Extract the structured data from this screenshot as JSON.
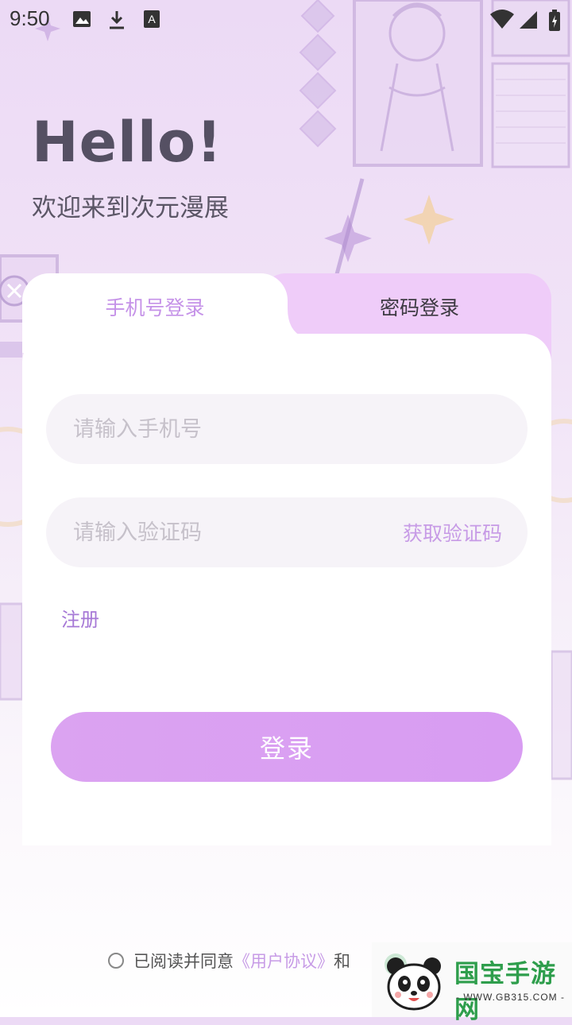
{
  "status_bar": {
    "time": "9:50",
    "icons": [
      "image-icon",
      "download-icon",
      "font-icon",
      "wifi-icon",
      "signal-icon",
      "battery-icon"
    ]
  },
  "greeting": {
    "title": "Hello!",
    "subtitle": "欢迎来到次元漫展"
  },
  "tabs": [
    {
      "label": "手机号登录",
      "active": true
    },
    {
      "label": "密码登录",
      "active": false
    }
  ],
  "form": {
    "phone": {
      "placeholder": "请输入手机号",
      "value": ""
    },
    "code": {
      "placeholder": "请输入验证码",
      "value": ""
    },
    "get_code": "获取验证码",
    "register": "注册",
    "login": "登录"
  },
  "agreement": {
    "prefix": "已阅读并同意",
    "user_agreement": "《用户协议》",
    "and": "和"
  },
  "watermark": {
    "name": "国宝手游网",
    "url": "- WWW.GB315.COM -"
  },
  "colors": {
    "accent": "#c592e8",
    "button": "#d89cf2",
    "tab_inactive_bg": "#efccf9",
    "title": "#555063"
  }
}
